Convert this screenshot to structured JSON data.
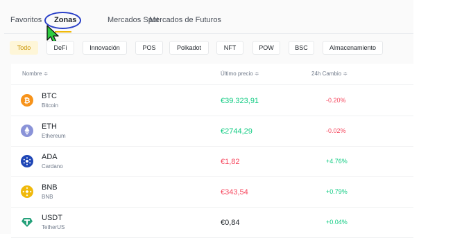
{
  "tabs": [
    {
      "label": "Favoritos",
      "active": false
    },
    {
      "label": "Zonas",
      "active": true
    },
    {
      "label": "Mercados Spot",
      "active": false
    },
    {
      "label": "Mercados de Futuros",
      "active": false
    }
  ],
  "filters": [
    {
      "label": "Todo",
      "active": true
    },
    {
      "label": "DeFi"
    },
    {
      "label": "Innovación"
    },
    {
      "label": "POS"
    },
    {
      "label": "Polkadot"
    },
    {
      "label": "NFT"
    },
    {
      "label": "POW"
    },
    {
      "label": "BSC"
    },
    {
      "label": "Almacenamiento"
    }
  ],
  "table": {
    "headers": {
      "name": "Nombre ≑",
      "price": "Último precio ≑",
      "change": "24h Cambio ≑"
    },
    "rows": [
      {
        "symbol": "BTC",
        "name": "Bitcoin",
        "price": "€39.323,91",
        "change": "-0.20%",
        "icon": "bitcoin-icon",
        "icon_color": "#f7931a",
        "price_color": "green",
        "change_color": "red"
      },
      {
        "symbol": "ETH",
        "name": "Ethereum",
        "price": "€2744,29",
        "change": "-0.02%",
        "icon": "ethereum-icon",
        "icon_color": "#8a93d8",
        "price_color": "green",
        "change_color": "red"
      },
      {
        "symbol": "ADA",
        "name": "Cardano",
        "price": "€1,82",
        "change": "+4.76%",
        "icon": "cardano-icon",
        "icon_color": "#1f46b6",
        "price_color": "red",
        "change_color": "green"
      },
      {
        "symbol": "BNB",
        "name": "BNB",
        "price": "€343,54",
        "change": "+0.79%",
        "icon": "bnb-icon",
        "icon_color": "#f0b90b",
        "price_color": "red",
        "change_color": "green"
      },
      {
        "symbol": "USDT",
        "name": "TetherUS",
        "price": "€0,84",
        "change": "+0.04%",
        "icon": "tether-icon",
        "icon_color": "#26a17b",
        "price_color": "dark",
        "change_color": "green"
      }
    ]
  },
  "colors": {
    "accent": "#f0b90b",
    "up": "#0ecb81",
    "down": "#f6465d",
    "annotation": "#2a40c8",
    "cursor": "#2ecc40"
  }
}
